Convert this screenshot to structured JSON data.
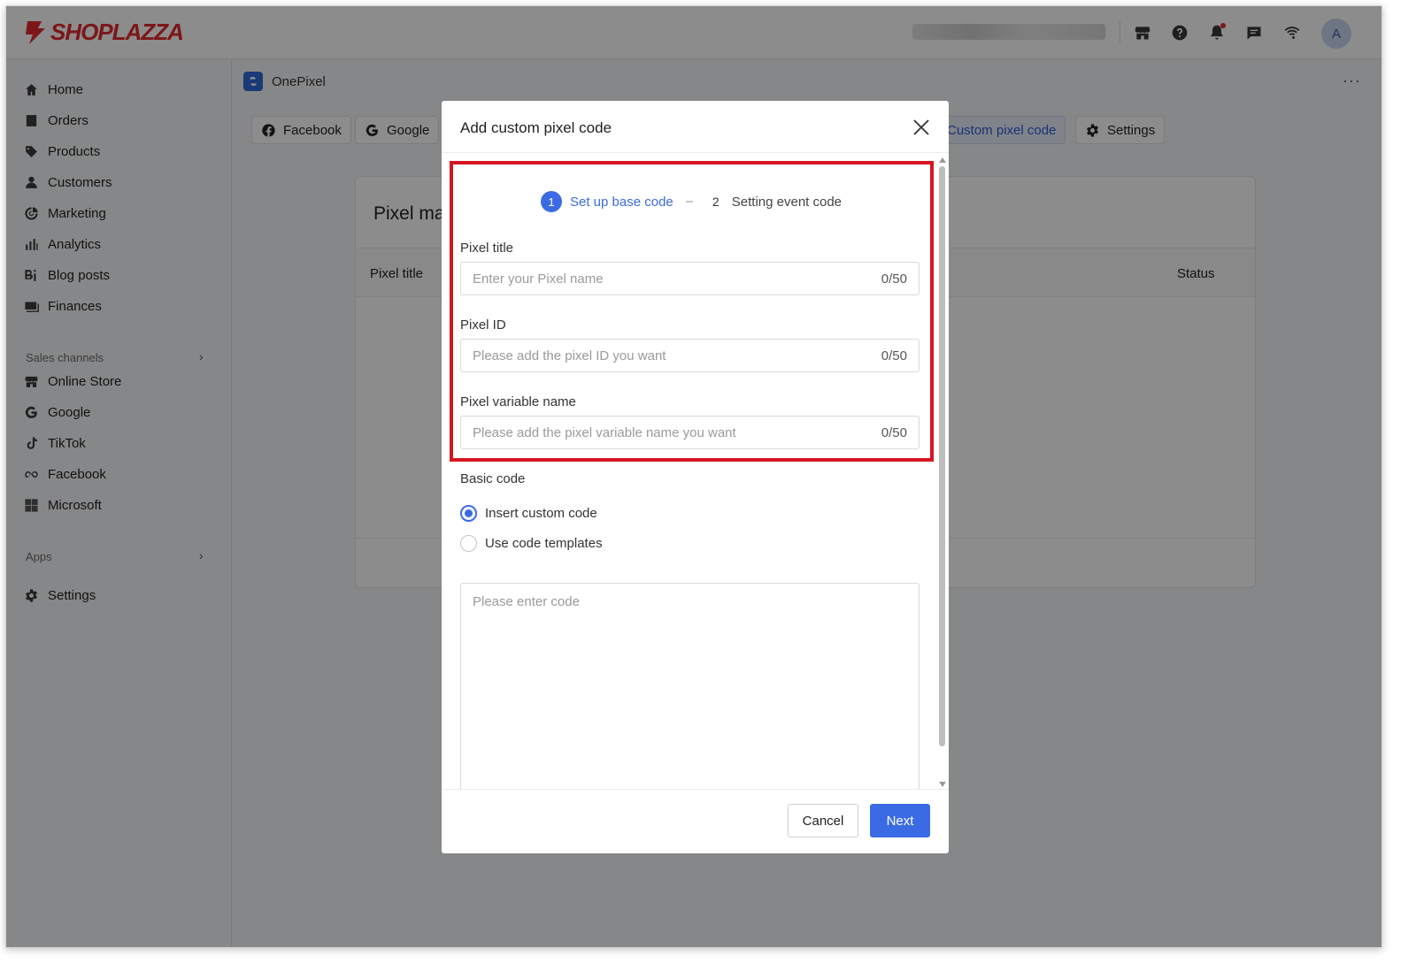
{
  "brand": {
    "name": "SHOPLAZZA",
    "color": "#e2282f"
  },
  "topbar": {
    "icons": [
      "store-icon",
      "help-icon",
      "bell-icon",
      "message-icon",
      "wifi-icon"
    ],
    "avatar_letter": "A"
  },
  "sidebar": {
    "main_items": [
      {
        "label": "Home",
        "icon": "home-icon"
      },
      {
        "label": "Orders",
        "icon": "orders-icon"
      },
      {
        "label": "Products",
        "icon": "tag-icon"
      },
      {
        "label": "Customers",
        "icon": "person-icon"
      },
      {
        "label": "Marketing",
        "icon": "marketing-icon"
      },
      {
        "label": "Analytics",
        "icon": "bar-chart-icon"
      },
      {
        "label": "Blog posts",
        "icon": "blog-icon"
      },
      {
        "label": "Finances",
        "icon": "finance-icon"
      }
    ],
    "sales_channels_label": "Sales channels",
    "channels": [
      {
        "label": "Online Store",
        "icon": "store-icon"
      },
      {
        "label": "Google",
        "icon": "google-icon"
      },
      {
        "label": "TikTok",
        "icon": "tiktok-icon"
      },
      {
        "label": "Facebook",
        "icon": "meta-icon"
      },
      {
        "label": "Microsoft",
        "icon": "microsoft-icon"
      }
    ],
    "apps_label": "Apps",
    "settings_label": "Settings"
  },
  "page": {
    "app_name": "OnePixel",
    "more": "···",
    "tabs": [
      {
        "label": "Facebook",
        "icon": "facebook-icon"
      },
      {
        "label": "Google",
        "icon": "google-icon"
      },
      {
        "label": "Custom pixel code",
        "active": true
      },
      {
        "label": "Settings",
        "icon": "gear-icon"
      }
    ],
    "card_title": "Pixel ma",
    "columns": {
      "pixel_title": "Pixel title",
      "status": "Status"
    }
  },
  "modal": {
    "title": "Add custom pixel code",
    "steps": [
      {
        "number": "1",
        "label": "Set up base code",
        "active": true
      },
      {
        "number": "2",
        "label": "Setting event code",
        "active": false
      }
    ],
    "fields": {
      "pixel_title": {
        "label": "Pixel title",
        "placeholder": "Enter your Pixel name",
        "count": "0/50"
      },
      "pixel_id": {
        "label": "Pixel ID",
        "placeholder": "Please add the pixel ID you want",
        "count": "0/50"
      },
      "pixel_variable": {
        "label": "Pixel variable name",
        "placeholder": "Please add the pixel variable name you want",
        "count": "0/50"
      }
    },
    "basic_code_label": "Basic code",
    "options": [
      {
        "label": "Insert custom code",
        "checked": true
      },
      {
        "label": "Use code templates",
        "checked": false
      }
    ],
    "code_placeholder": "Please enter code",
    "cancel_label": "Cancel",
    "next_label": "Next"
  },
  "colors": {
    "accent": "#3b6be4",
    "highlight": "#d6161f"
  }
}
